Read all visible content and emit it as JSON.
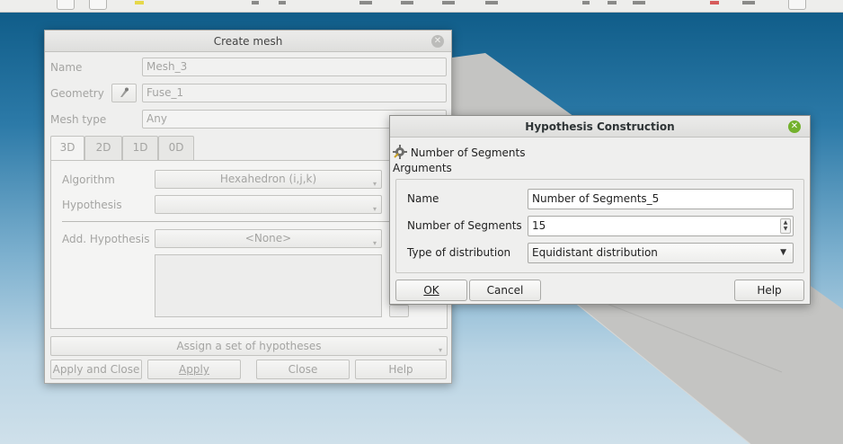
{
  "create_mesh": {
    "title": "Create mesh",
    "name_label": "Name",
    "name_value": "Mesh_3",
    "geometry_label": "Geometry",
    "geometry_value": "Fuse_1",
    "mesh_type_label": "Mesh type",
    "mesh_type_value": "Any",
    "tabs": [
      "3D",
      "2D",
      "1D",
      "0D"
    ],
    "algorithm_label": "Algorithm",
    "algorithm_value": "Hexahedron (i,j,k)",
    "hypothesis_label": "Hypothesis",
    "hypothesis_value": "",
    "add_hypothesis_label": "Add. Hypothesis",
    "add_hypothesis_value": "<None>",
    "assign_set": "Assign a set of hypotheses",
    "buttons": {
      "apply_close": "Apply and Close",
      "apply": "Apply",
      "close": "Close",
      "help": "Help"
    }
  },
  "hypothesis_dialog": {
    "title": "Hypothesis Construction",
    "header": "Number of Segments",
    "arguments_label": "Arguments",
    "name_label": "Name",
    "name_value": "Number of Segments_5",
    "segments_label": "Number of Segments",
    "segments_value": "15",
    "distribution_label": "Type of distribution",
    "distribution_value": "Equidistant distribution",
    "buttons": {
      "ok": "OK",
      "cancel": "Cancel",
      "help": "Help"
    }
  },
  "colors": {
    "viewport_top": "#0d5a86",
    "viewport_bottom": "#cfe0ea",
    "mesh_surface": "#c4c4c2",
    "close_active": "#73b12d"
  },
  "icons": {
    "geometry_select": "arrow-select-icon",
    "hypothesis_header": "hypothesis-gear-icon"
  }
}
